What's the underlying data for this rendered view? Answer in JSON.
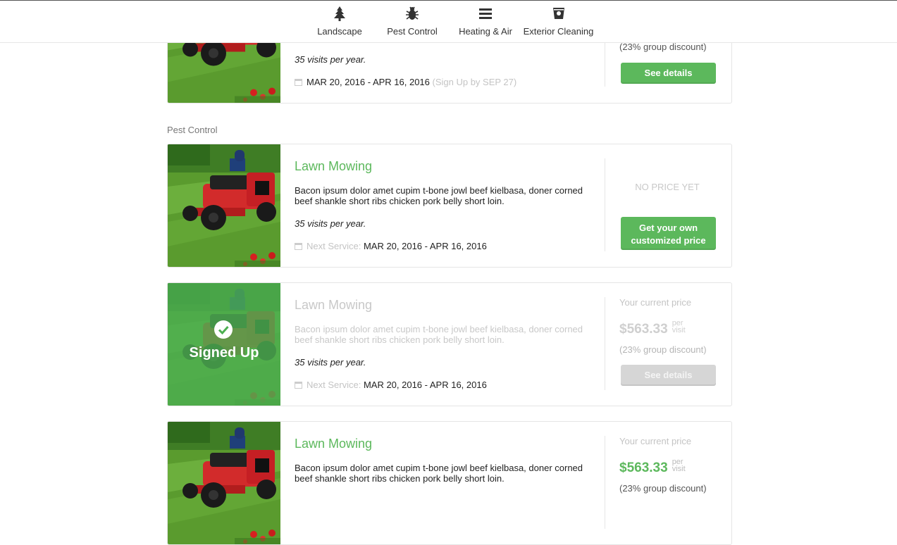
{
  "nav": [
    {
      "label": "Landscape",
      "icon": "tree-icon"
    },
    {
      "label": "Pest Control",
      "icon": "bug-icon"
    },
    {
      "label": "Heating & Air",
      "icon": "bars-icon"
    },
    {
      "label": "Exterior Cleaning",
      "icon": "bucket-icon"
    }
  ],
  "section_label": "Pest Control",
  "cards": [
    {
      "title": "",
      "visits": "35 visits per year.",
      "date_prefix": "",
      "dates": "MAR 20, 2016 - APR 16, 2016",
      "signup_note": "(Sign Up by SEP 27)",
      "discount": "(23% group discount)",
      "button": "See details"
    },
    {
      "title": "Lawn Mowing",
      "description": "Bacon ipsum dolor amet cupim t-bone jowl beef kielbasa, doner corned beef shankle short ribs chicken pork belly short loin.",
      "visits": "35 visits per year.",
      "date_prefix": "Next Service:",
      "dates": "MAR 20, 2016 - APR 16, 2016",
      "no_price": "NO PRICE YET",
      "button_line1": "Get your own",
      "button_line2": "customized price"
    },
    {
      "title": "Lawn Mowing",
      "description": "Bacon ipsum dolor amet cupim t-bone jowl beef kielbasa, doner corned beef shankle short ribs chicken pork belly short loin.",
      "visits": "35 visits per year.",
      "date_prefix": "Next Service:",
      "dates": "MAR 20, 2016 - APR 16, 2016",
      "status": "Signed Up",
      "price_label": "Your current price",
      "price": "$563.33",
      "per_1": "per",
      "per_2": "visit",
      "discount": "(23% group discount)",
      "button": "See details"
    },
    {
      "title": "Lawn Mowing",
      "description": "Bacon ipsum dolor amet cupim t-bone jowl beef kielbasa, doner corned beef shankle short ribs chicken pork belly short loin.",
      "price_label": "Your current price",
      "price": "$563.33",
      "per_1": "per",
      "per_2": "visit",
      "discount": "(23% group discount)"
    }
  ],
  "colors": {
    "accent": "#5cb85c",
    "muted": "#c4c4c4",
    "signed_overlay": "#4caf50"
  }
}
